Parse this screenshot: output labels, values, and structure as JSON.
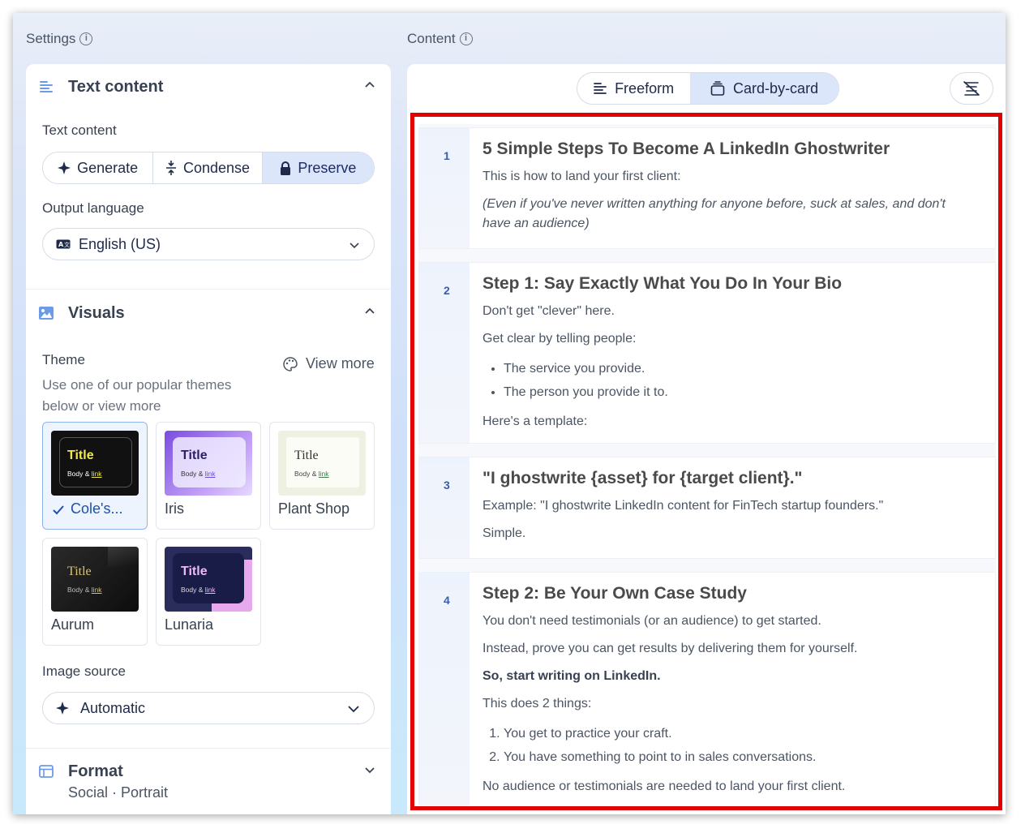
{
  "settings": {
    "label": "Settings",
    "text_section": {
      "title": "Text content",
      "field_label": "Text content",
      "modes": [
        {
          "label": "Generate"
        },
        {
          "label": "Condense"
        },
        {
          "label": "Preserve"
        }
      ],
      "active_mode": "Preserve",
      "language_label": "Output language",
      "language_value": "English (US)"
    },
    "visuals_section": {
      "title": "Visuals",
      "theme_label": "Theme",
      "theme_desc": "Use one of our popular themes below or view more",
      "view_more": "View more",
      "thumb_title": "Title",
      "thumb_body": "Body &",
      "thumb_link": "link",
      "themes": [
        {
          "name": "Cole's...",
          "selected": true
        },
        {
          "name": "Iris",
          "selected": false
        },
        {
          "name": "Plant Shop",
          "selected": false
        },
        {
          "name": "Aurum",
          "selected": false
        },
        {
          "name": "Lunaria",
          "selected": false
        }
      ],
      "image_source_label": "Image source",
      "image_source_value": "Automatic"
    },
    "format_section": {
      "title": "Format",
      "subtitle": "Social · Portrait"
    }
  },
  "content": {
    "label": "Content",
    "modes": {
      "freeform": "Freeform",
      "card_by_card": "Card-by-card"
    },
    "active_mode": "Card-by-card",
    "cards": [
      {
        "num": "1",
        "title": "5 Simple Steps To Become A LinkedIn Ghostwriter",
        "p1": "This is how to land your first client:",
        "p2": "(Even if you've never written anything for anyone before, suck at sales, and don't have an audience)"
      },
      {
        "num": "2",
        "title": "Step 1: Say Exactly What You Do In Your Bio",
        "p1": "Don't get \"clever\" here.",
        "p2": "Get clear by telling people:",
        "bullets": [
          "The service you provide.",
          "The person you provide it to."
        ],
        "p3": "Here's a template:"
      },
      {
        "num": "3",
        "title": "\"I ghostwrite {asset} for {target client}.\"",
        "p1": "Example: \"I ghostwrite LinkedIn content for FinTech startup founders.\"",
        "p2": "Simple."
      },
      {
        "num": "4",
        "title": "Step 2: Be Your Own Case Study",
        "p1": "You don't need testimonials (or an audience) to get started.",
        "p2": "Instead, prove you can get results by delivering them for yourself.",
        "p3": "So, start writing on LinkedIn.",
        "p4": "This does 2 things:",
        "items": [
          "You get to practice your craft.",
          "You have something to point to in sales conversations."
        ],
        "p5": "No audience or testimonials are needed to land your first client."
      }
    ]
  },
  "colors": {
    "accent": "#1e4fb0",
    "highlight_border": "#e30000",
    "active_segment": "#dbe6fb"
  }
}
